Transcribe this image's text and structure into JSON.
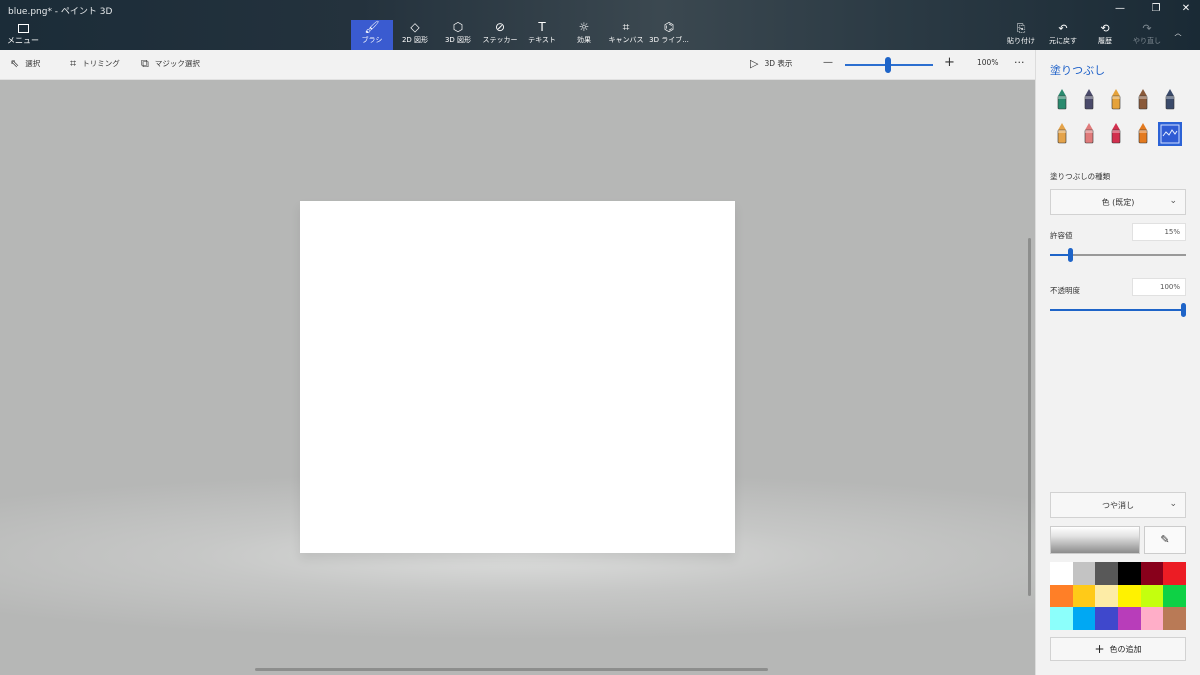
{
  "window": {
    "title": "blue.png* - ペイント 3D",
    "minimize": "—",
    "restore": "❐",
    "close": "✕"
  },
  "ribbon": {
    "menu_label": "メニュー",
    "tools": [
      {
        "label": "ブラシ",
        "icon": "brush-icon",
        "glyph": "🖌",
        "active": true
      },
      {
        "label": "2D 図形",
        "icon": "2d-shapes-icon",
        "glyph": "◇"
      },
      {
        "label": "3D 図形",
        "icon": "3d-shapes-icon",
        "glyph": "⬡"
      },
      {
        "label": "ステッカー",
        "icon": "sticker-icon",
        "glyph": "⊘"
      },
      {
        "label": "テキスト",
        "icon": "text-icon",
        "glyph": "T"
      },
      {
        "label": "効果",
        "icon": "effects-icon",
        "glyph": "☼"
      },
      {
        "label": "キャンバス",
        "icon": "canvas-icon",
        "glyph": "⌗"
      },
      {
        "label": "3D ライブ...",
        "icon": "3d-library-icon",
        "glyph": "⌬"
      }
    ],
    "right_tools": [
      {
        "label": "貼り付け",
        "icon": "paste-icon",
        "glyph": "⎘"
      },
      {
        "label": "元に戻す",
        "icon": "undo-icon",
        "glyph": "↶"
      },
      {
        "label": "履歴",
        "icon": "history-icon",
        "glyph": "⟲"
      },
      {
        "label": "やり直し",
        "icon": "redo-icon",
        "glyph": "↷",
        "disabled": true
      }
    ],
    "collapse_glyph": "︿"
  },
  "commandbar": {
    "select_label": "選択",
    "crop_label": "トリミング",
    "magic_select_label": "マジック選択",
    "view3d_label": "3D 表示",
    "zoom_out": "—",
    "zoom_in": "+",
    "zoom_value": "100%",
    "zoom_level": 0.45,
    "more": "···"
  },
  "panel": {
    "title": "塗りつぶし",
    "brushes": [
      {
        "name": "marker",
        "color": "#2a8a6e"
      },
      {
        "name": "calligraphy-pen",
        "color": "#4a4a6a"
      },
      {
        "name": "oil-brush",
        "color": "#e5a23a"
      },
      {
        "name": "watercolor",
        "color": "#8a5a3a"
      },
      {
        "name": "pixel-pen",
        "color": "#3a4a6a"
      },
      {
        "name": "pencil",
        "color": "#e4a34a"
      },
      {
        "name": "eraser",
        "color": "#e07b7b"
      },
      {
        "name": "crayon",
        "color": "#d2304e"
      },
      {
        "name": "spray-can",
        "color": "#e37a1f"
      },
      {
        "name": "fill",
        "color": "#2f5bd4",
        "selected": true
      }
    ],
    "fill_type_label": "塗りつぶしの種類",
    "fill_type_value": "色 (既定)",
    "tolerance_label": "許容値",
    "tolerance_value": "15%",
    "tolerance_level": 0.15,
    "opacity_label": "不透明度",
    "opacity_value": "100%",
    "opacity_level": 1.0,
    "finish_value": "つや消し",
    "picker_glyph": "✎",
    "palette": [
      "#ffffff",
      "#c3c3c3",
      "#585858",
      "#000000",
      "#88001b",
      "#ec1c24",
      "#ff7f27",
      "#ffca18",
      "#fdeca6",
      "#fff200",
      "#c4ff0e",
      "#0ed145",
      "#8cfffb",
      "#00a8f3",
      "#3f48cc",
      "#b83dba",
      "#ffaec8",
      "#b97a56"
    ],
    "add_color_label": "色の追加"
  }
}
